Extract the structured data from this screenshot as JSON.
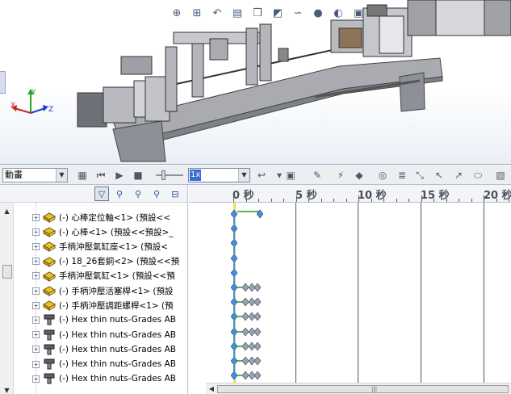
{
  "view_toolbar": {
    "icons": [
      "zoom-to-fit-icon",
      "zoom-to-area-icon",
      "previous-view-icon",
      "section-view-icon",
      "view-orientation-icon",
      "display-style-icon",
      "hide-show-items-icon",
      "edit-appearance-icon",
      "apply-scene-icon",
      "view-settings-icon"
    ]
  },
  "triad": {
    "x": "X",
    "y": "Y",
    "z": "Z"
  },
  "motion_toolbar": {
    "study_type": "動畫",
    "playback_speed": "1x",
    "icons": [
      "calculate-icon",
      "play-from-start-icon",
      "play-icon",
      "stop-icon",
      "playback-mode-icon",
      "save-animation-icon",
      "animation-wizard-icon",
      "autokey-icon",
      "add-update-key-icon",
      "motor-icon",
      "spring-icon",
      "damper-icon",
      "force-icon",
      "contact-icon",
      "gravity-icon",
      "results-icon"
    ]
  },
  "filter_bar": {
    "icons": [
      "filter-animated-icon",
      "filter-driving-icon",
      "filter-selected-icon",
      "filter-results-icon",
      "filter-collapse-icon"
    ]
  },
  "tree": {
    "rows": [
      {
        "expander": "+",
        "icon": "part-icon",
        "label": "(-) 心棒定位軸<1> (預設<<"
      },
      {
        "expander": "+",
        "icon": "part-icon",
        "label": "(-) 心棒<1> (預設<<預設>_"
      },
      {
        "expander": "+",
        "icon": "part-icon",
        "label": "手柄沖壓氣缸座<1> (預設<"
      },
      {
        "expander": "+",
        "icon": "part-icon",
        "label": "(-) 18_26套銅<2> (預設<<預"
      },
      {
        "expander": "+",
        "icon": "part-icon",
        "label": "手柄沖壓氣缸<1> (預設<<預"
      },
      {
        "expander": "+",
        "icon": "part-icon",
        "label": "(-) 手柄沖壓活塞桿<1> (預設"
      },
      {
        "expander": "+",
        "icon": "part-icon",
        "label": "(-) 手柄沖壓調距螺桿<1> (預"
      },
      {
        "expander": "+",
        "icon": "fastener-icon",
        "label": "(-) Hex thin nuts-Grades AB"
      },
      {
        "expander": "+",
        "icon": "fastener-icon",
        "label": "(-) Hex thin nuts-Grades AB"
      },
      {
        "expander": "+",
        "icon": "fastener-icon",
        "label": "(-) Hex thin nuts-Grades AB"
      },
      {
        "expander": "+",
        "icon": "fastener-icon",
        "label": "(-) Hex thin nuts-Grades AB"
      },
      {
        "expander": "+",
        "icon": "fastener-icon",
        "label": "(-) Hex thin nuts-Grades AB"
      }
    ]
  },
  "timeline": {
    "labels": [
      "0 秒",
      "5 秒",
      "10 秒",
      "15 秒",
      "20 秒"
    ],
    "current_time_s": 0
  },
  "colors": {
    "time_bar": "#f1d66a",
    "key_blue": "#3f8fe6",
    "key_gray": "#9aa2ad",
    "key_line": "#44c04c",
    "part_yellow": "#e9c02e"
  }
}
